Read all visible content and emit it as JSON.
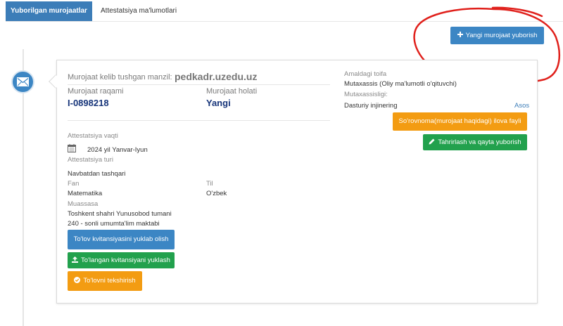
{
  "tabs": [
    {
      "label": "Yuborilgan murojaatlar",
      "active": true
    },
    {
      "label": "Attestatsiya ma'lumotlari",
      "active": false
    }
  ],
  "header": {
    "new_button": "Yangi murojaat yuborish"
  },
  "card": {
    "address_label": "Murojaat kelib tushgan manzil:",
    "address_value": "pedkadr.uzedu.uz",
    "number_label": "Murojaat raqami",
    "number_value": "I-0898218",
    "status_label": "Murojaat holati",
    "status_value": "Yangi",
    "attestation_time_label": "Attestatsiya vaqti",
    "attestation_time_value": "2024 yil Yanvar-Iyun",
    "attestation_type_label": "Attestatsiya turi",
    "attestation_type_value": "Navbatdan tashqari",
    "subject_label": "Fan",
    "subject_value": "Matematika",
    "language_label": "Til",
    "language_value": "O'zbek",
    "institution_label": "Muassasa",
    "institution_line1": "Toshkent shahri Yunusobod tumani",
    "institution_line2": "240 - sonli umumta'lim maktabi",
    "current_category_label": "Amaldagi toifa",
    "current_category_value": "Mutaxassis (Oliy ma'lumotli o'qituvchi)",
    "specialty_label": "Mutaxassisligi:",
    "specialty_value": "Dasturiy injinering",
    "basis_link": "Asos",
    "btn_reference": "So'rovnoma(murojaat haqidagi) ilova fayli",
    "btn_edit": "Tahrirlash va qayta yuborish",
    "btn_download_receipt": "To'lov kvitansiyasini yuklab olish",
    "btn_upload_receipt": "To'langan kvitansiyani yuklash",
    "btn_check_payment": "To'lovni tekshirish"
  },
  "colors": {
    "primary": "#3c86c4",
    "success": "#22a14d",
    "warning": "#f39c12",
    "annotation": "#e0201b"
  }
}
